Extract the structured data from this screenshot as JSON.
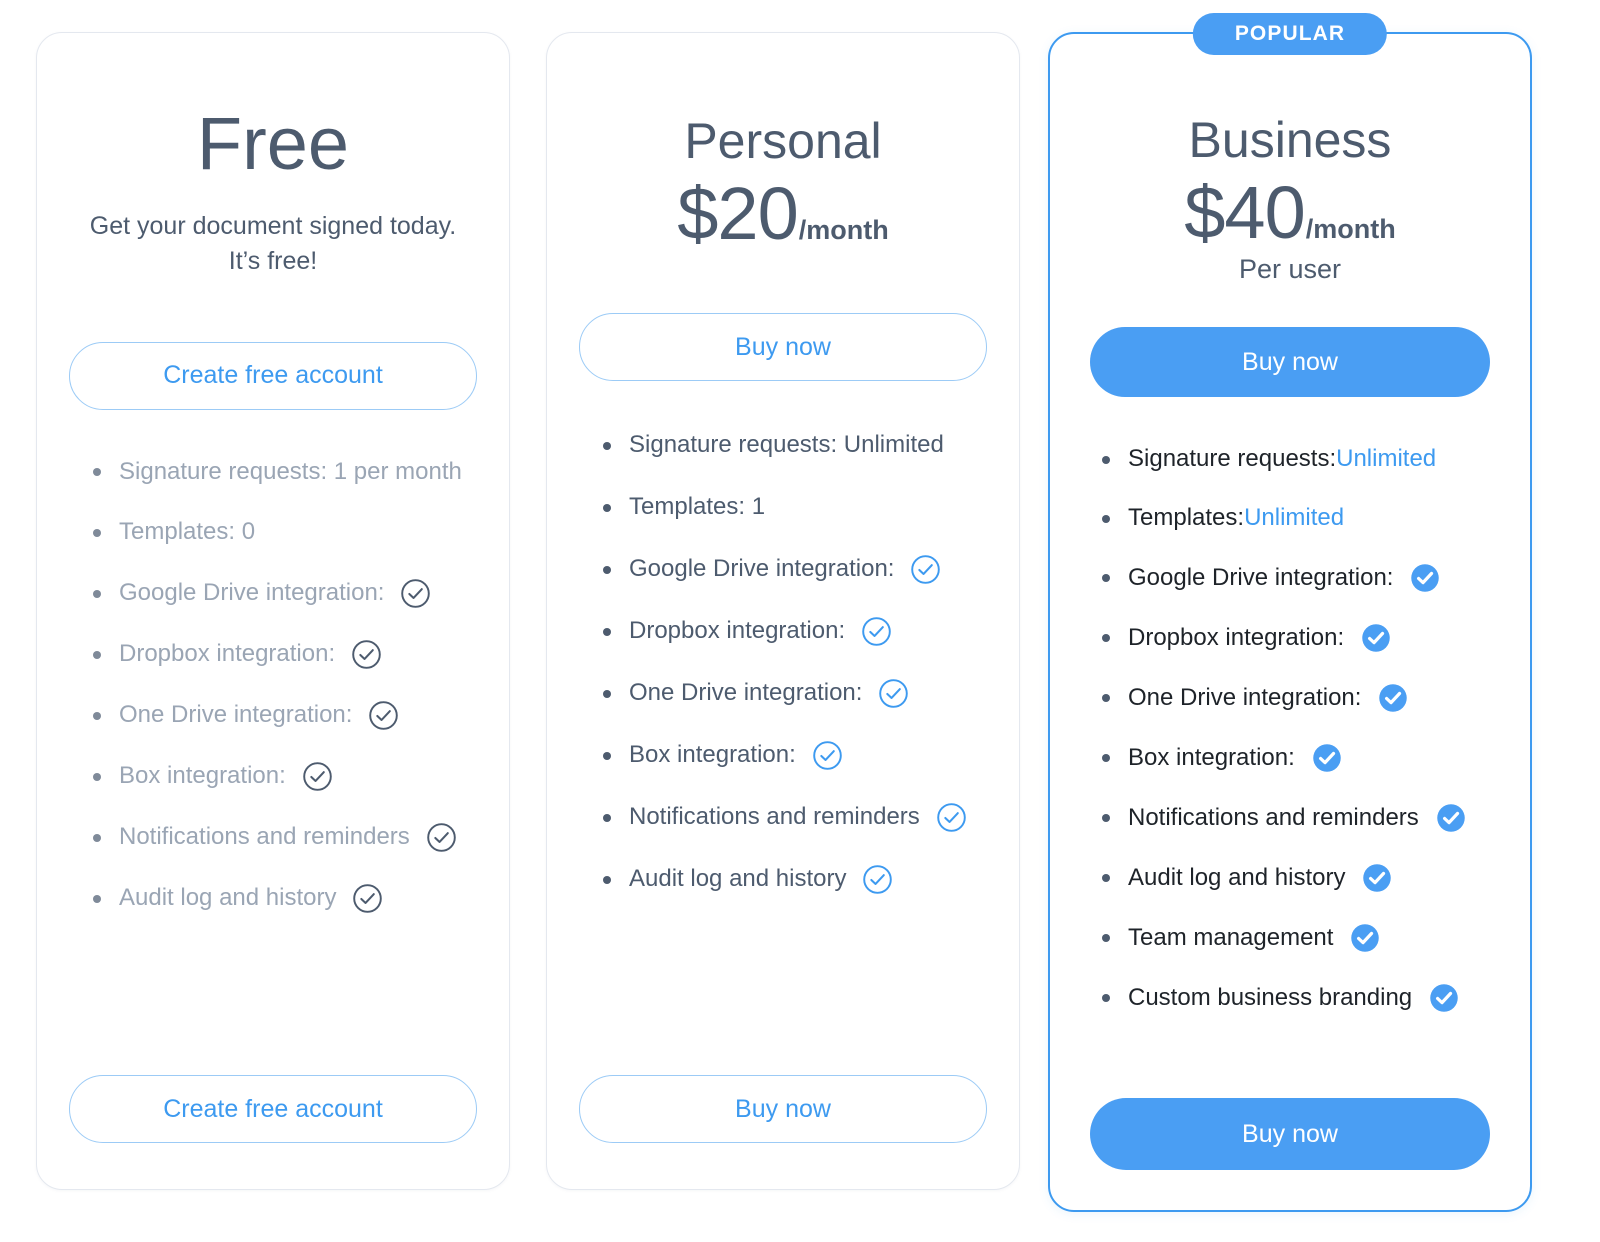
{
  "colors": {
    "accent_blue": "#4a9ef3",
    "link_blue": "#3d9af0",
    "text_slate": "#4d5b6e",
    "text_muted": "#9aa5b4",
    "text_dark": "#1e2329",
    "card_border": "#e4e8ef",
    "page_bg": "#ffffff"
  },
  "plans": [
    {
      "id": "free",
      "name": "Free",
      "tagline": "Get your document signed today. It’s free!",
      "price": "",
      "period": "",
      "subnote": "",
      "cta_top_label": "Create free account",
      "cta_bottom_label": "Create free account",
      "badge": "",
      "features": [
        {
          "label": "Signature requests: 1 per month",
          "highlight": "",
          "check": "none"
        },
        {
          "label": "Templates: 0",
          "highlight": "",
          "check": "none"
        },
        {
          "label": "Google Drive integration:",
          "highlight": "",
          "check": "outline-dark"
        },
        {
          "label": "Dropbox integration:",
          "highlight": "",
          "check": "outline-dark"
        },
        {
          "label": "One Drive integration:",
          "highlight": "",
          "check": "outline-dark"
        },
        {
          "label": "Box integration:",
          "highlight": "",
          "check": "outline-dark"
        },
        {
          "label": "Notifications and reminders",
          "highlight": "",
          "check": "outline-dark"
        },
        {
          "label": "Audit log and history",
          "highlight": "",
          "check": "outline-dark"
        }
      ]
    },
    {
      "id": "personal",
      "name": "Personal",
      "tagline": "",
      "price": "$20",
      "period": "/month",
      "subnote": "",
      "cta_top_label": "Buy now",
      "cta_bottom_label": "Buy now",
      "badge": "",
      "features": [
        {
          "label": "Signature requests: Unlimited",
          "highlight": "",
          "check": "none"
        },
        {
          "label": "Templates: 1",
          "highlight": "",
          "check": "none"
        },
        {
          "label": "Google Drive integration:",
          "highlight": "",
          "check": "outline-blue"
        },
        {
          "label": "Dropbox integration:",
          "highlight": "",
          "check": "outline-blue"
        },
        {
          "label": "One Drive integration:",
          "highlight": "",
          "check": "outline-blue"
        },
        {
          "label": "Box integration:",
          "highlight": "",
          "check": "outline-blue"
        },
        {
          "label": "Notifications and reminders",
          "highlight": "",
          "check": "outline-blue"
        },
        {
          "label": "Audit log and history",
          "highlight": "",
          "check": "outline-blue"
        }
      ]
    },
    {
      "id": "business",
      "name": "Business",
      "tagline": "",
      "price": "$40",
      "period": "/month",
      "subnote": "Per user",
      "cta_top_label": "Buy now",
      "cta_bottom_label": "Buy now",
      "badge": "POPULAR",
      "features": [
        {
          "label": "Signature requests: ",
          "highlight": "Unlimited",
          "check": "none"
        },
        {
          "label": "Templates: ",
          "highlight": "Unlimited",
          "check": "none"
        },
        {
          "label": "Google Drive integration:",
          "highlight": "",
          "check": "filled"
        },
        {
          "label": "Dropbox integration:",
          "highlight": "",
          "check": "filled"
        },
        {
          "label": "One Drive integration:",
          "highlight": "",
          "check": "filled"
        },
        {
          "label": "Box integration:",
          "highlight": "",
          "check": "filled"
        },
        {
          "label": "Notifications and reminders",
          "highlight": "",
          "check": "filled"
        },
        {
          "label": "Audit log and history",
          "highlight": "",
          "check": "filled"
        },
        {
          "label": "Team management",
          "highlight": "",
          "check": "filled"
        },
        {
          "label": "Custom business branding",
          "highlight": "",
          "check": "filled"
        }
      ]
    }
  ]
}
